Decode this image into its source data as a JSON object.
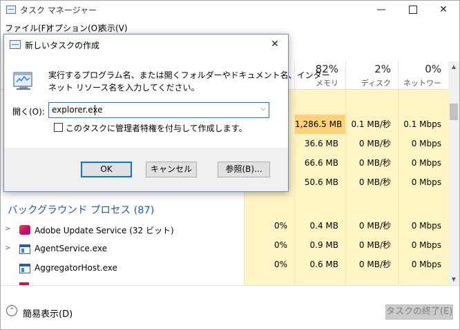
{
  "window": {
    "title": "タスク マネージャー",
    "min": "—",
    "close": "✕"
  },
  "menu": [
    "ファイル(F)",
    "オプション(O)",
    "表示(V)"
  ],
  "columns": [
    {
      "pct": "82%",
      "label": "メモリ"
    },
    {
      "pct": "2%",
      "label": "ディスク"
    },
    {
      "pct": "0%",
      "label": "ネットワーク"
    }
  ],
  "table": {
    "apps_rows": [
      {
        "cpu": "",
        "mem": "1,286.5 MB",
        "disk": "0.1 MB/秒",
        "net": "0.1 Mbps"
      },
      {
        "cpu": "",
        "mem": "36.6 MB",
        "disk": "0 MB/秒",
        "net": "0 Mbps"
      },
      {
        "cpu": "",
        "mem": "66.6 MB",
        "disk": "0 MB/秒",
        "net": "0 Mbps"
      },
      {
        "cpu": "",
        "mem": "50.6 MB",
        "disk": "0 MB/秒",
        "net": "0 Mbps"
      }
    ],
    "background_group": "バックグラウンド プロセス (87)",
    "background_rows": [
      {
        "name": "Adobe Update Service (32 ビット)",
        "icon": "adobe-icon",
        "expandable": true,
        "cpu": "0%",
        "mem": "0.4 MB",
        "disk": "0 MB/秒",
        "net": "0 Mbps"
      },
      {
        "name": "AgentService.exe",
        "icon": "app-window-icon",
        "expandable": true,
        "cpu": "0%",
        "mem": "0.9 MB",
        "disk": "0 MB/秒",
        "net": "0 Mbps"
      },
      {
        "name": "AggregatorHost.exe",
        "icon": "app-window-icon",
        "expandable": false,
        "cpu": "0%",
        "mem": "0.6 MB",
        "disk": "0 MB/秒",
        "net": "0 Mbps"
      }
    ]
  },
  "footer": {
    "fewer_details": "簡易表示(D)",
    "end_task": "タスクの終了(E)"
  },
  "dialog": {
    "title": "新しいタスクの作成",
    "message_line1": "実行するプログラム名、または開くフォルダーやドキュメント名、インター",
    "message_line2": "ネット リソース名を入力してください。",
    "open_label": "開く(O):",
    "open_value": "explorer.exe",
    "admin_checked": false,
    "admin_label": "このタスクに管理者特権を付与して作成します。",
    "ok": "OK",
    "cancel": "キャンセル",
    "browse": "参照(B)..."
  },
  "colors": {
    "heat_light": "#fff4c4",
    "heat_strong": "#ffd27a",
    "group_header": "#1f59a8",
    "accent": "#0078d7"
  }
}
